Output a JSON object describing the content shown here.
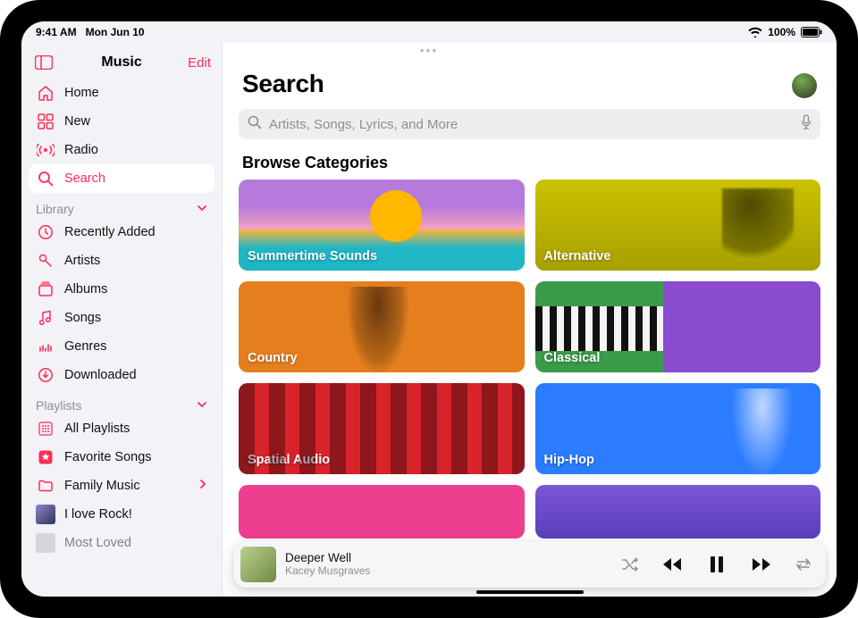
{
  "status": {
    "time": "9:41 AM",
    "date": "Mon Jun 10",
    "battery": "100%"
  },
  "sidebar": {
    "title": "Music",
    "edit": "Edit",
    "items": [
      {
        "label": "Home"
      },
      {
        "label": "New"
      },
      {
        "label": "Radio"
      },
      {
        "label": "Search"
      }
    ],
    "library_header": "Library",
    "library": [
      {
        "label": "Recently Added"
      },
      {
        "label": "Artists"
      },
      {
        "label": "Albums"
      },
      {
        "label": "Songs"
      },
      {
        "label": "Genres"
      },
      {
        "label": "Downloaded"
      }
    ],
    "playlists_header": "Playlists",
    "playlists": [
      {
        "label": "All Playlists"
      },
      {
        "label": "Favorite Songs"
      },
      {
        "label": "Family Music"
      },
      {
        "label": "I love Rock!"
      },
      {
        "label": "Most Loved"
      }
    ]
  },
  "main": {
    "title": "Search",
    "search_placeholder": "Artists, Songs, Lyrics, and More",
    "section": "Browse Categories",
    "categories": [
      {
        "label": "Summertime Sounds"
      },
      {
        "label": "Alternative"
      },
      {
        "label": "Country"
      },
      {
        "label": "Classical"
      },
      {
        "label": "Spatial Audio"
      },
      {
        "label": "Hip-Hop"
      },
      {
        "label": ""
      },
      {
        "label": ""
      }
    ]
  },
  "now_playing": {
    "title": "Deeper Well",
    "artist": "Kacey Musgraves"
  }
}
